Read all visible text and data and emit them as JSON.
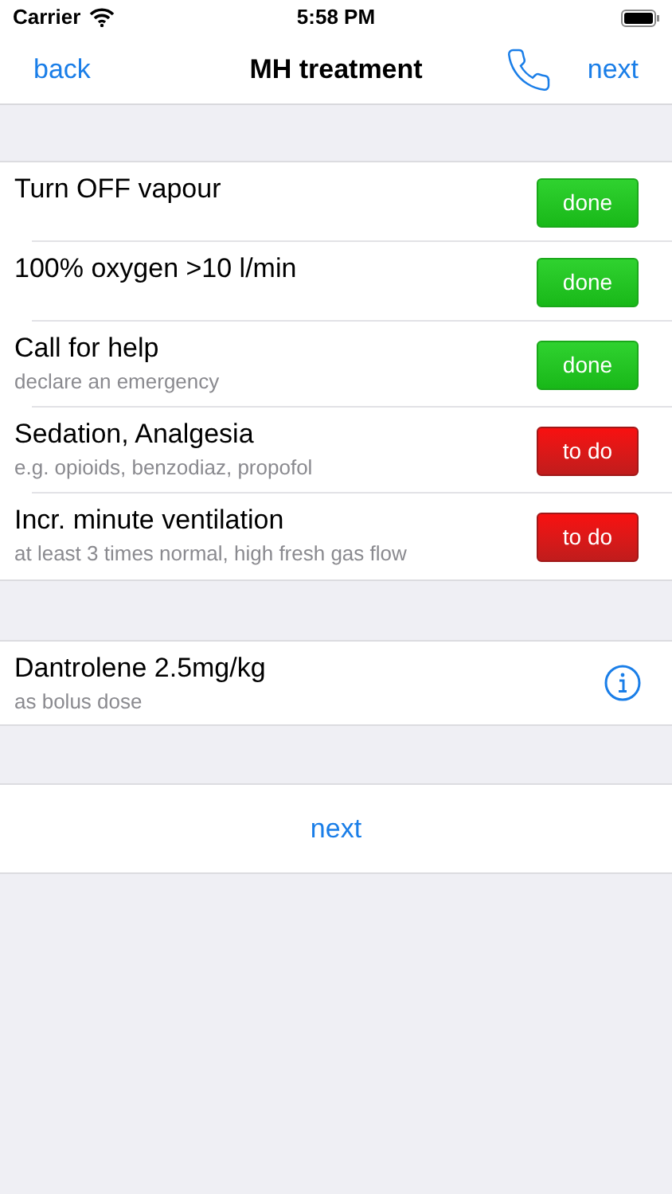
{
  "status_bar": {
    "carrier": "Carrier",
    "time": "5:58 PM"
  },
  "nav": {
    "back": "back",
    "title": "MH treatment",
    "next": "next"
  },
  "steps": [
    {
      "title": "Turn OFF vapour",
      "done": true,
      "button": "done"
    },
    {
      "title": "100% oxygen >10 l/min",
      "done": true,
      "button": "done"
    },
    {
      "title": "Call for help",
      "subtitle": "declare an emergency",
      "done": true,
      "button": "done"
    },
    {
      "title": "Sedation, Analgesia",
      "subtitle": "e.g. opioids, benzodiaz, propofol",
      "done": false,
      "button": "to do"
    },
    {
      "title": "Incr. minute ventilation",
      "subtitle": "at least 3 times normal, high fresh gas flow",
      "done": false,
      "button": "to do"
    }
  ],
  "drug": {
    "title": "Dantrolene 2.5mg/kg",
    "subtitle": "as bolus dose"
  },
  "next_button": "next"
}
